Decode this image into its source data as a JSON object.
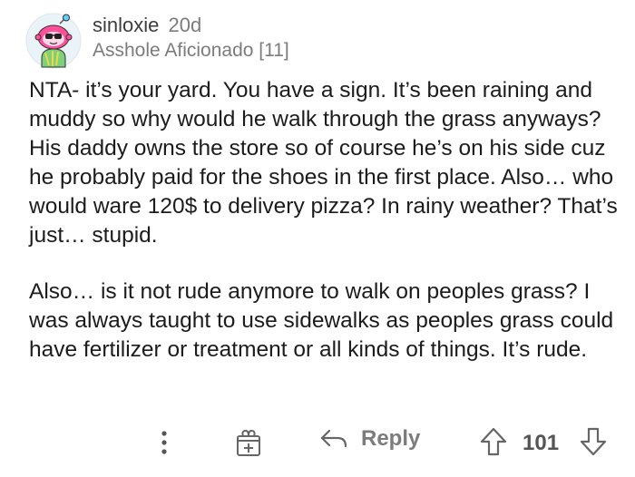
{
  "comment": {
    "username": "sinloxie",
    "age": "20d",
    "flair": "Asshole Aficionado [11]",
    "avatar_icon": "snoo-avatar-icon",
    "paragraphs": [
      "NTA- it’s your yard. You have a sign. It’s been raining and muddy so why would he walk through the grass anyways? His daddy owns the store so of course he’s on his side cuz he probably paid for the shoes in the first place. Also… who would ware 120$ to delivery pizza? In rainy weather? That’s just… stupid.",
      "Also… is it not rude anymore to walk on peoples grass? I was always taught to use sidewalks as peoples grass could have fertilizer or treatment or all kinds of things. It’s rude."
    ]
  },
  "actions": {
    "more_icon": "more-vertical-icon",
    "award_icon": "gift-award-icon",
    "reply_icon": "reply-arrow-icon",
    "reply_label": "Reply",
    "upvote_icon": "upvote-arrow-icon",
    "score": "101",
    "downvote_icon": "downvote-arrow-icon"
  },
  "colors": {
    "text": "#1c1c1c",
    "muted": "#7c7c7c",
    "avatar_head": "#ff4f9a",
    "avatar_bg": "#e9f3f8"
  }
}
